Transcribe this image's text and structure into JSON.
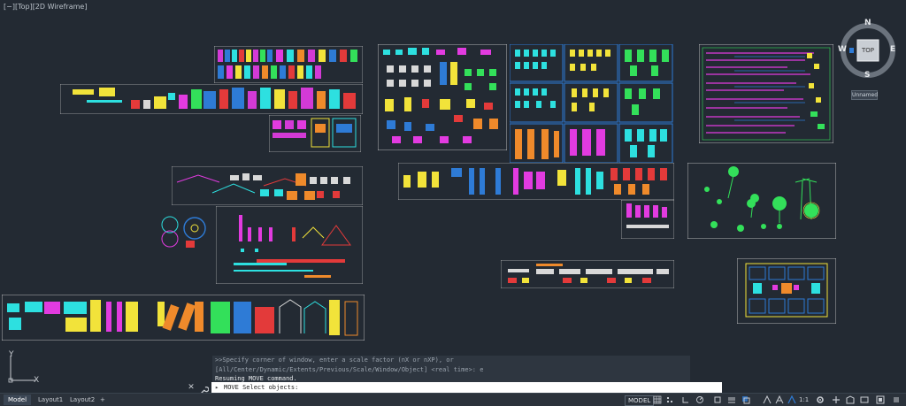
{
  "viewport": {
    "label": "[−][Top][2D Wireframe]",
    "background": "#232a33"
  },
  "viewcube": {
    "face": "TOP",
    "north": "N",
    "south": "S",
    "east": "E",
    "west": "W",
    "wcs_label": "Unnamed"
  },
  "ucs": {
    "x": "X",
    "y": "Y"
  },
  "command_line": {
    "history": [
      ">>Specify corner of window, enter a scale factor (nX or nXP), or",
      "[All/Center/Dynamic/Extents/Previous/Scale/Window/Object] <real time>:  e",
      "Resuming MOVE command."
    ],
    "close_icon": "close-icon",
    "customize_icon": "wrench-icon",
    "prompt_glyph": "▸",
    "input_text": "MOVE Select objects:"
  },
  "status_bar": {
    "tabs": [
      {
        "label": "Model",
        "active": true
      },
      {
        "label": "Layout1",
        "active": false
      },
      {
        "label": "Layout2",
        "active": false
      }
    ],
    "add_tab": "+",
    "model_button": "MODEL",
    "scale": "1:1",
    "icons": [
      "grid-icon",
      "snap-icon",
      "ortho-icon",
      "polar-icon",
      "osnap-icon",
      "lineweight-icon",
      "transparency-icon",
      "annotation-scale-icon",
      "workspace-gear-icon",
      "plus-icon",
      "isolate-icon",
      "hardware-acceleration-icon",
      "clean-screen-icon",
      "customize-icon"
    ]
  },
  "colors": {
    "accent_blue": "#2e7bd6",
    "cyan": "#2de0e0",
    "magenta": "#e23be0",
    "yellow": "#f2e33a",
    "green": "#33e05a",
    "red": "#e33a3a",
    "orange": "#ef8a2b",
    "frame": "#d8d8d8"
  }
}
